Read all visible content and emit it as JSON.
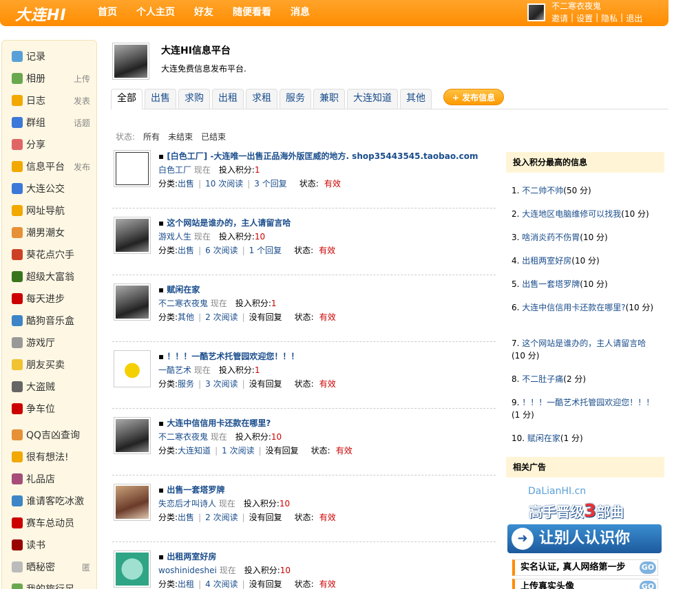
{
  "header": {
    "logo": "大连HI",
    "nav": [
      "首页",
      "个人主页",
      "好友",
      "随便看看",
      "消息"
    ],
    "username": "不二寒衣夜鬼",
    "user_links": [
      "邀请",
      "设置",
      "隐私",
      "退出"
    ]
  },
  "sidebar": {
    "items": [
      {
        "label": "记录",
        "extra": "",
        "icon": "record-icon",
        "color": "#5aa0d8"
      },
      {
        "label": "相册",
        "extra": "上传",
        "icon": "album-icon",
        "color": "#6aa84f"
      },
      {
        "label": "日志",
        "extra": "发表",
        "icon": "blog-icon",
        "color": "#f1a800"
      },
      {
        "label": "群组",
        "extra": "话题",
        "icon": "group-icon",
        "color": "#3c78d8"
      },
      {
        "label": "分享",
        "extra": "",
        "icon": "share-icon",
        "color": "#e06666"
      },
      {
        "label": "信息平台",
        "extra": "发布",
        "icon": "info-icon",
        "color": "#f1a800"
      },
      {
        "label": "大连公交",
        "extra": "",
        "icon": "bus-icon",
        "color": "#3c78d8"
      },
      {
        "label": "网址导航",
        "extra": "",
        "icon": "nav-icon",
        "color": "#f1a800"
      },
      {
        "label": "潮男潮女",
        "extra": "",
        "icon": "people-icon",
        "color": "#e69138"
      },
      {
        "label": "葵花点穴手",
        "extra": "",
        "icon": "hand-icon",
        "color": "#cc4125"
      },
      {
        "label": "超级大富翁",
        "extra": "",
        "icon": "money-icon",
        "color": "#38761d"
      },
      {
        "label": "每天进步",
        "extra": "",
        "icon": "percent-icon",
        "color": "#cc0000"
      },
      {
        "label": "酷狗音乐盒",
        "extra": "",
        "icon": "music-icon",
        "color": "#3d85c6"
      },
      {
        "label": "游戏厅",
        "extra": "",
        "icon": "game-icon",
        "color": "#999999"
      },
      {
        "label": "朋友买卖",
        "extra": "",
        "icon": "coin-icon",
        "color": "#f1c232"
      },
      {
        "label": "大盗贼",
        "extra": "",
        "icon": "thief-icon",
        "color": "#666666"
      },
      {
        "label": "争车位",
        "extra": "",
        "icon": "parking-icon",
        "color": "#cc0000"
      },
      {
        "label": "QQ吉凶查询",
        "extra": "",
        "icon": "qq-icon",
        "color": "#e69138"
      },
      {
        "label": "很有想法!",
        "extra": "",
        "icon": "idea-icon",
        "color": "#f1a800"
      },
      {
        "label": "礼品店",
        "extra": "",
        "icon": "gift-icon",
        "color": "#a64d79"
      },
      {
        "label": "谁请客吃冰激",
        "extra": "",
        "icon": "icecream-icon",
        "color": "#3d85c6"
      },
      {
        "label": "赛车总动员",
        "extra": "",
        "icon": "car-icon",
        "color": "#cc0000"
      },
      {
        "label": "读书",
        "extra": "",
        "icon": "book-icon",
        "color": "#990000"
      },
      {
        "label": "晒秘密",
        "extra": "匿",
        "icon": "secret-icon",
        "color": "#bbbbbb"
      },
      {
        "label": "我的旅行足",
        "extra": "",
        "icon": "travel-icon",
        "color": "#6aa84f"
      }
    ]
  },
  "profile": {
    "title": "大连HI信息平台",
    "desc": "大连免费信息发布平台."
  },
  "tabs": [
    "全部",
    "出售",
    "求购",
    "出租",
    "求租",
    "服务",
    "兼职",
    "大连知道",
    "其他"
  ],
  "publish_label": "发布信息",
  "status_filter": {
    "label": "状态:",
    "options": [
      "所有",
      "未结束",
      "已结束"
    ]
  },
  "labels": {
    "time_now": "现在",
    "points": "投入积分:",
    "category": "分类:",
    "state": "状态:",
    "views_suffix": "次阅读",
    "replies_suffix": "个回复",
    "no_reply": "没有回复"
  },
  "posts": [
    {
      "title": "[白色工厂] -大连唯一出售正品海外版匡威的地方. shop35443545.taobao.com",
      "author": "白色工厂",
      "points": "1",
      "category": "出售",
      "views": "10",
      "replies": "3",
      "state": "有效",
      "thumb": "shop"
    },
    {
      "title": "这个网站是谁办的，主人请留言哈",
      "author": "游戏人生",
      "points": "10",
      "category": "出售",
      "views": "6",
      "replies": "1",
      "state": "有效",
      "thumb": "photo"
    },
    {
      "title": "赋闲在家",
      "author": "不二寒衣夜鬼",
      "points": "1",
      "category": "其他",
      "views": "2",
      "replies": "",
      "state": "有效",
      "thumb": "photo"
    },
    {
      "title": "！！！一酷艺术托管园欢迎您！！！",
      "author": "一酷艺术",
      "points": "1",
      "category": "服务",
      "views": "3",
      "replies": "",
      "state": "有效",
      "thumb": "art"
    },
    {
      "title": "大连中信信用卡还款在哪里?",
      "author": "不二寒衣夜鬼",
      "points": "10",
      "category": "大连知道",
      "views": "1",
      "replies": "",
      "state": "有效",
      "thumb": "photo"
    },
    {
      "title": "出售一套塔罗牌",
      "author": "失恋后才叫诗人",
      "points": "10",
      "category": "出售",
      "views": "2",
      "replies": "",
      "state": "有效",
      "thumb": "photo2"
    },
    {
      "title": "出租两室好房",
      "author": "woshinideshei",
      "points": "10",
      "category": "出租",
      "views": "4",
      "replies": "",
      "state": "有效",
      "thumb": "cartoon"
    }
  ],
  "ranking": {
    "title": "投入积分最高的信息",
    "items": [
      {
        "text": "不二帅不帅",
        "points": "(50 分)"
      },
      {
        "text": "大连地区电脑维修可以找我",
        "points": "(10 分)"
      },
      {
        "text": "啥消炎药不伤胃",
        "points": "(10 分)"
      },
      {
        "text": "出租两室好房",
        "points": "(10 分)"
      },
      {
        "text": "出售一套塔罗牌",
        "points": "(10 分)"
      },
      {
        "text": "大连中信信用卡还款在哪里?",
        "points": "(10 分)"
      },
      {
        "text": "这个网站是谁办的，主人请留言哈",
        "points": "(10 分)"
      },
      {
        "text": "不二肚子痛",
        "points": "(2 分)"
      },
      {
        "text": "！！！一酷艺术托管园欢迎您！！！",
        "points": "(1 分)"
      },
      {
        "text": "赋闲在家",
        "points": "(1 分)"
      }
    ]
  },
  "ads": {
    "title": "相关广告",
    "domain": "DaLianHI.cn",
    "banner1_a": "高手晋级",
    "banner1_num": "3",
    "banner1_b": "部曲",
    "banner2": "让别人认识你",
    "row1": "实名认证, 真人网络第一步",
    "row2": "上传真实头像",
    "go": "GO"
  }
}
